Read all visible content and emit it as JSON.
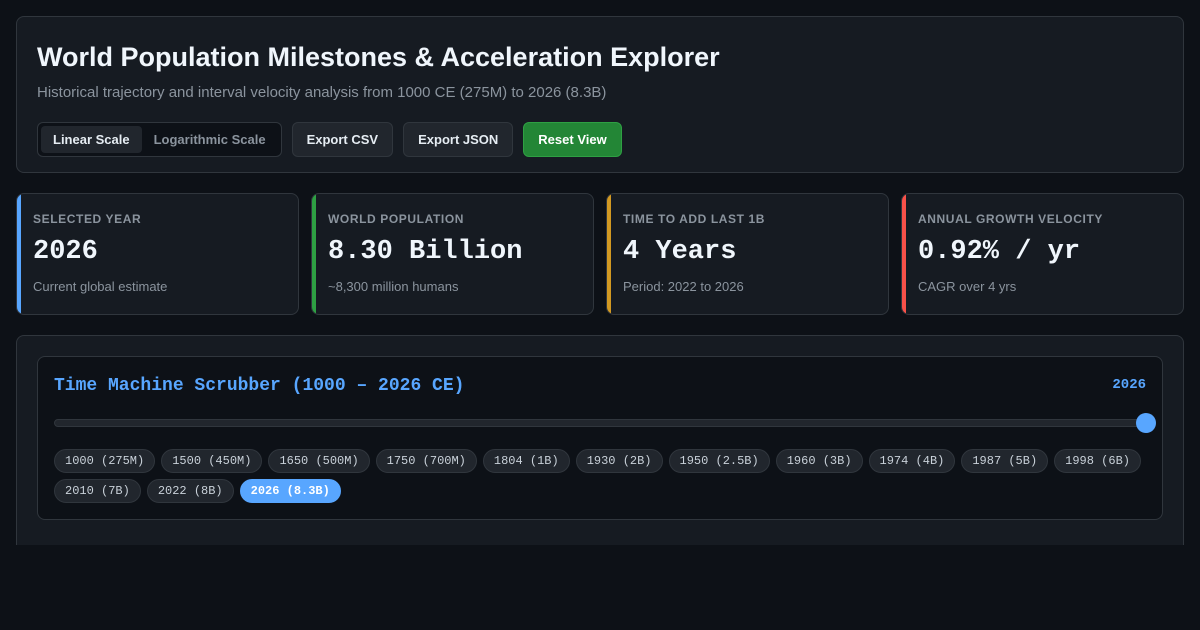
{
  "header": {
    "title": "World Population Milestones & Acceleration Explorer",
    "subtitle": "Historical trajectory and interval velocity analysis from 1000 CE (275M) to 2026 (8.3B)"
  },
  "controls": {
    "scale_options": [
      "Linear Scale",
      "Logarithmic Scale"
    ],
    "active_scale": "Linear Scale",
    "export_csv": "Export CSV",
    "export_json": "Export JSON",
    "reset_view": "Reset View"
  },
  "stats": [
    {
      "label": "SELECTED YEAR",
      "value": "2026",
      "sub": "Current global estimate",
      "accent": "#58a6ff"
    },
    {
      "label": "WORLD POPULATION",
      "value": "8.30 Billion",
      "sub": "~8,300 million humans",
      "accent": "#2ea043"
    },
    {
      "label": "TIME TO ADD LAST 1B",
      "value": "4 Years",
      "sub": "Period: 2022 to 2026",
      "accent": "#d29922"
    },
    {
      "label": "ANNUAL GROWTH VELOCITY",
      "value": "0.92% / yr",
      "sub": "CAGR over 4 yrs",
      "accent": "#f85149"
    }
  ],
  "scrubber": {
    "title": "Time Machine Scrubber (1000 – 2026 CE)",
    "current_year": "2026",
    "slider_min": 1000,
    "slider_max": 2026,
    "slider_value": 2026,
    "milestones": [
      "1000 (275M)",
      "1500 (450M)",
      "1650 (500M)",
      "1750 (700M)",
      "1804 (1B)",
      "1930 (2B)",
      "1950 (2.5B)",
      "1960 (3B)",
      "1974 (4B)",
      "1987 (5B)",
      "1998 (6B)",
      "2010 (7B)",
      "2022 (8B)",
      "2026 (8.3B)"
    ],
    "active_milestone": "2026 (8.3B)"
  },
  "colors": {
    "background": "#0d1117",
    "accent_blue": "#58a6ff",
    "primary_green": "#238636"
  }
}
